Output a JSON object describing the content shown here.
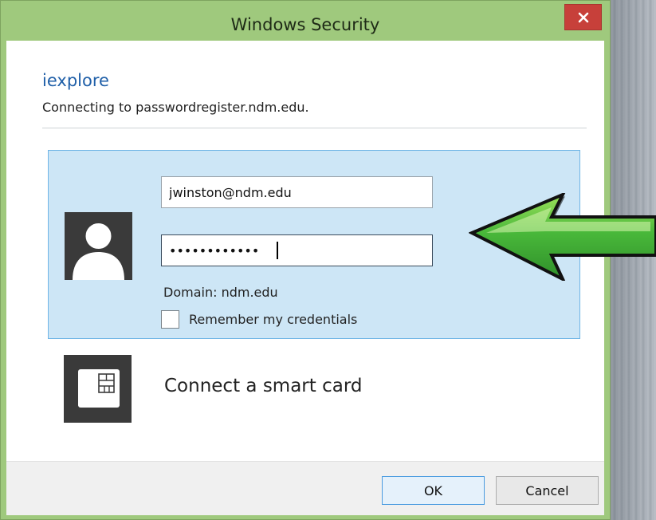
{
  "window": {
    "title": "Windows Security",
    "close_symbol": "×"
  },
  "header": {
    "app_name": "iexplore",
    "connecting_text": "Connecting to passwordregister.ndm.edu."
  },
  "credentials": {
    "username_value": "jwinston@ndm.edu",
    "password_value": "••••••••••••",
    "domain_text": "Domain: ndm.edu",
    "remember_label": "Remember my credentials",
    "remember_checked": false
  },
  "smartcard": {
    "label": "Connect a smart card"
  },
  "footer": {
    "ok_label": "OK",
    "cancel_label": "Cancel"
  },
  "icons": {
    "avatar": "user-avatar-icon",
    "smartcard": "smart-card-icon",
    "close": "close-icon",
    "arrow": "arrow-left-icon"
  },
  "colors": {
    "frame": "#9fc97d",
    "close_button": "#c7403a",
    "accent_link": "#1f5fa8",
    "tile_background": "#cde6f6",
    "tile_border": "#6fb5e6",
    "arrow_green": "#49b83a"
  }
}
